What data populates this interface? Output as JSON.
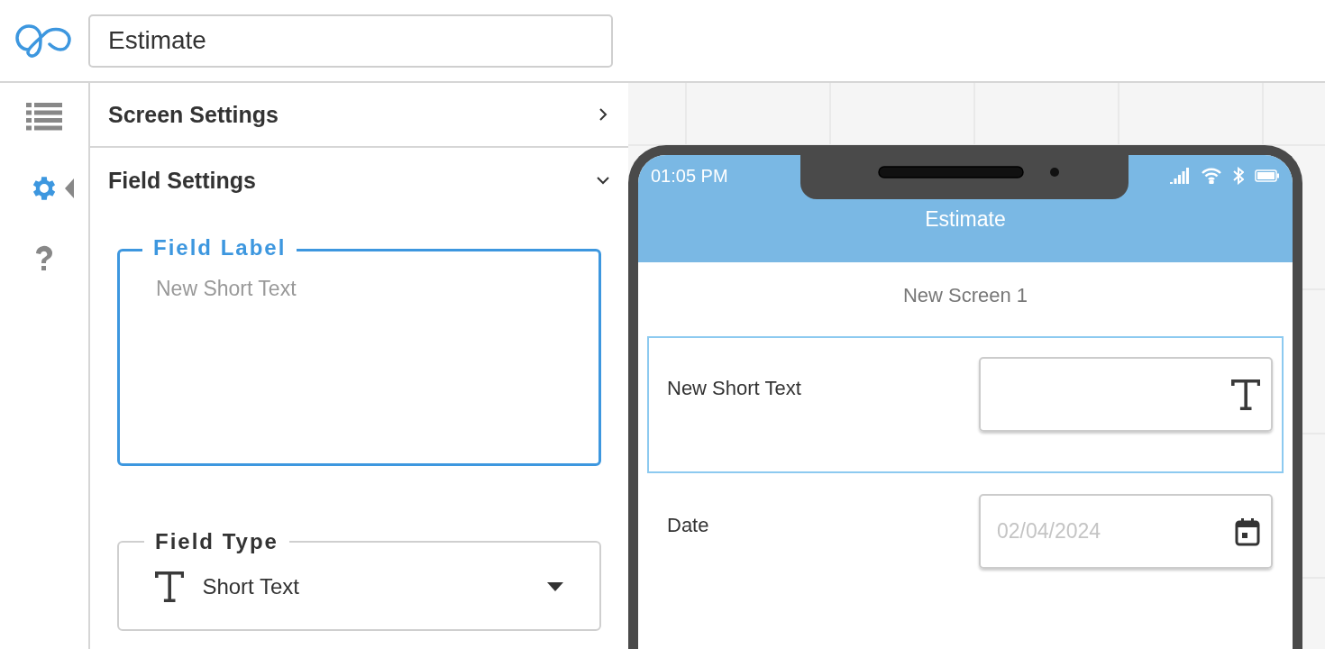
{
  "header": {
    "app_name_field": {
      "value": "Estimate"
    }
  },
  "rail": [
    {
      "kind": "list",
      "selected": false
    },
    {
      "kind": "settings",
      "selected": true
    },
    {
      "kind": "help",
      "selected": false
    }
  ],
  "panel": {
    "sections": [
      {
        "title": "Screen Settings",
        "expanded": false
      },
      {
        "title": "Field Settings",
        "expanded": true
      }
    ],
    "field_label": {
      "legend": "Field Label",
      "placeholder": "New Short Text",
      "focused": true
    },
    "field_type": {
      "legend": "Field Type",
      "value": "Short Text"
    }
  },
  "phone": {
    "time": "01:05 PM",
    "title": "Estimate",
    "screen_name": "New Screen 1",
    "fields": [
      {
        "kind": "text",
        "label": "New Short Text",
        "selected": true
      },
      {
        "kind": "date",
        "label": "Date",
        "placeholder": "02/04/2024",
        "selected": false
      }
    ]
  }
}
